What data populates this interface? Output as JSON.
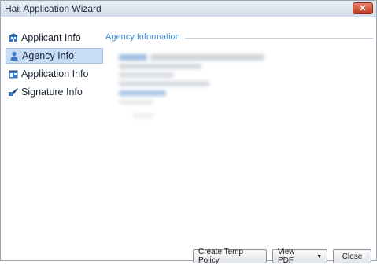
{
  "window": {
    "title": "Hail Application Wizard",
    "close_label": "✕"
  },
  "sidebar": {
    "items": [
      {
        "label": "Applicant Info",
        "icon": "building-icon",
        "selected": false
      },
      {
        "label": "Agency Info",
        "icon": "person-icon",
        "selected": true
      },
      {
        "label": "Application Info",
        "icon": "calendar-icon",
        "selected": false
      },
      {
        "label": "Signature Info",
        "icon": "signature-icon",
        "selected": false
      }
    ]
  },
  "main": {
    "section_title": "Agency Information"
  },
  "buttons": {
    "create_temp_policy": "Create Temp Policy",
    "view_pdf": "View PDF",
    "close": "Close"
  },
  "colors": {
    "accent": "#3d8ad6",
    "selected_bg": "#c7dcf5",
    "close_button": "#c43b22"
  }
}
